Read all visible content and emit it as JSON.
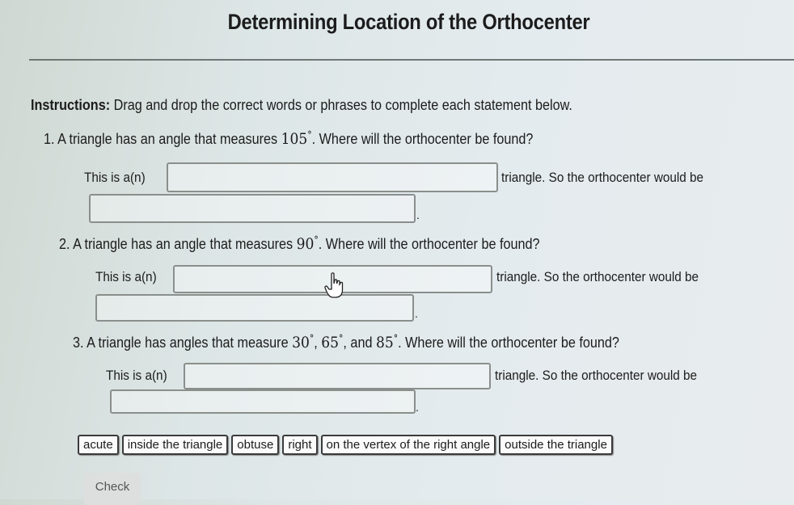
{
  "title": "Determining Location of the Orthocenter",
  "instructions": {
    "label": "Instructions:",
    "text": " Drag and drop the correct words or phrases to complete each statement below."
  },
  "questions": [
    {
      "prefix": "1. A triangle has an angle that measures ",
      "math": "105",
      "deg": "°",
      "suffix": ". Where will the orthocenter be found?",
      "stmt_start": "This is a(n)",
      "stmt_mid": "triangle. So the orthocenter would be",
      "blank1": "",
      "blank2": ""
    },
    {
      "prefix": "2. A triangle has an angle that measures ",
      "math": "90",
      "deg": "°",
      "suffix": ". Where will the orthocenter be found?",
      "stmt_start": "This is a(n)",
      "stmt_mid": "triangle. So the orthocenter would be",
      "blank1": "",
      "blank2": ""
    },
    {
      "prefix": "3. A triangle has angles that measure ",
      "math_a": "30",
      "math_b": "65",
      "math_c": "85",
      "deg": "°",
      "sep1": ", ",
      "sep2": ", and ",
      "suffix": ". Where will the orthocenter be found?",
      "stmt_start": "This is a(n)",
      "stmt_mid": "triangle. So the orthocenter would be",
      "blank1": "",
      "blank2": ""
    }
  ],
  "period": ".",
  "word_bank": [
    "acute",
    "inside the triangle",
    "obtuse",
    "right",
    "on the vertex of the right angle",
    "outside the triangle"
  ],
  "check_label": "Check",
  "cursor_icon": "hand-pointer-icon"
}
